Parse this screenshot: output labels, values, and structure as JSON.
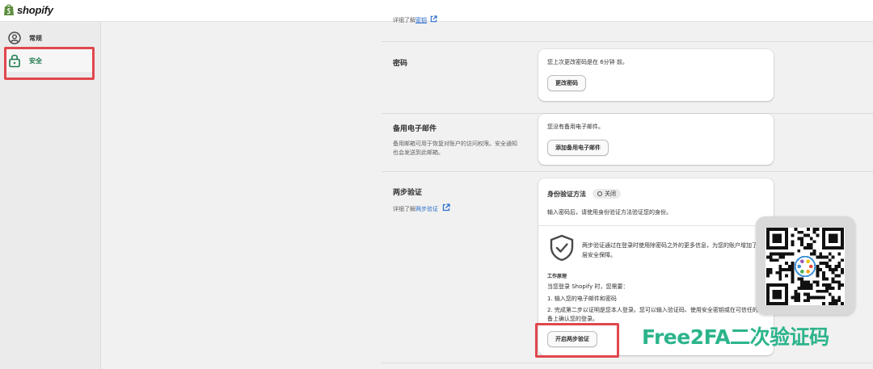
{
  "header": {
    "logo_text": "shopify"
  },
  "sidebar": {
    "items": [
      {
        "label": "常规",
        "icon": "user-circle-icon"
      },
      {
        "label": "安全",
        "icon": "lock-icon",
        "active": true
      }
    ]
  },
  "main": {
    "top_partial_link": {
      "prefix": "详细了解",
      "link": "密钥"
    },
    "password": {
      "title": "密码",
      "card_text": "您上次更改密码是在 6分钟 前。",
      "button": "更改密码"
    },
    "backup_email": {
      "title": "备用电子邮件",
      "description": "备用邮箱可用于恢复对账户的访问权限。安全通知也会发送到此邮箱。",
      "card_text": "您没有备用电子邮件。",
      "button": "添加备用电子邮件"
    },
    "two_step": {
      "title": "两步验证",
      "desc_prefix": "详细了解",
      "desc_link": "两步验证",
      "card_title": "身份验证方法",
      "status_badge": "关闭",
      "card_subtitle": "输入密码后，请使用身份验证方法验证您的身份。",
      "info_text": "两步验证通过在登录时使用除密码之外的更多信息，为您的账户增加了一层安全保障。",
      "how_title": "工作原理",
      "how_intro": "当您登录 Shopify 时，您需要：",
      "step1": "1. 输入您的电子邮件和密码",
      "step2": "2. 完成第二步以证明是您本人登录。您可以输入验证码、使用安全密钥或在可信任的设备上确认您的登录。",
      "button": "开启两步验证"
    }
  },
  "overlay": {
    "watermark_text": "Free2FA二次验证码",
    "qr_icon": "qr-code-icon"
  },
  "colors": {
    "highlight": "#e0474c",
    "link": "#2c6ecb",
    "active_nav": "#1f7a4f",
    "watermark": "#2cb48c"
  }
}
